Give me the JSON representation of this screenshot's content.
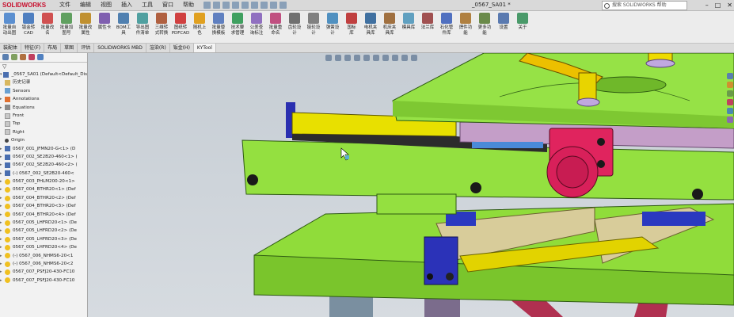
{
  "app": {
    "logo_text": "SOLIDWORKS",
    "doc_title": "_0567_SA01 *",
    "search_placeholder": "搜索 SOLIDWORKS 帮助",
    "menus": [
      "文件",
      "编辑",
      "视图",
      "插入",
      "工具",
      "窗口",
      "帮助"
    ]
  },
  "ribbon": {
    "buttons": [
      {
        "label": "批量自\n动出图",
        "color": "#5b8fd0"
      },
      {
        "label": "钣金转\nCAD",
        "color": "#4f7fc0"
      },
      {
        "label": "批量改\n名",
        "color": "#d05050"
      },
      {
        "label": "批量加\n图号",
        "color": "#60a060"
      },
      {
        "label": "批量改\n属性",
        "color": "#c09030"
      },
      {
        "label": "属性卡",
        "color": "#8060b0"
      },
      {
        "label": "BOM工\n具",
        "color": "#5080b0"
      },
      {
        "label": "导出图\n件清单",
        "color": "#50a0a0"
      },
      {
        "label": "三维转\n式转换",
        "color": "#b06040"
      },
      {
        "label": "图纸转\nPDFCAD",
        "color": "#d04040"
      },
      {
        "label": "随机上\n色",
        "color": "#e0a020"
      },
      {
        "label": "批量替\n换模板",
        "color": "#6080c0"
      },
      {
        "label": "技术要\n求管理",
        "color": "#40a060"
      },
      {
        "label": "公差查\n询标注",
        "color": "#9070c0"
      },
      {
        "label": "批量重\n命名",
        "color": "#c05080"
      },
      {
        "label": "齿轮设\n计",
        "color": "#707070"
      },
      {
        "label": "链轮设\n计",
        "color": "#808080"
      },
      {
        "label": "弹簧设\n计",
        "color": "#5090c0"
      },
      {
        "label": "国标\n库",
        "color": "#c04040"
      },
      {
        "label": "电机夹\n具库",
        "color": "#4070a0"
      },
      {
        "label": "机床夹\n具库",
        "color": "#a07040"
      },
      {
        "label": "模具库",
        "color": "#60a0c0"
      },
      {
        "label": "法兰库",
        "color": "#a05050"
      },
      {
        "label": "石化管\n件库",
        "color": "#5070c0"
      },
      {
        "label": "焊件功\n能",
        "color": "#b08040"
      },
      {
        "label": "更多功\n能",
        "color": "#6a8a4a"
      },
      {
        "label": "设置",
        "color": "#5a7ab0"
      },
      {
        "label": "关于",
        "color": "#4a9a6a"
      }
    ]
  },
  "tabs": [
    "装配体",
    "特征(F)",
    "布局",
    "草图",
    "评估",
    "SOLIDWORKS MBD",
    "渲染(R)",
    "钣金(H)",
    "KYTool"
  ],
  "tabs_active_index": 8,
  "tree": {
    "root": "_0567_SA01 (Default<Default_Dis",
    "items": [
      {
        "icon": "folder",
        "label": "历史记录",
        "exp": ""
      },
      {
        "icon": "sensor",
        "label": "Sensors",
        "exp": ""
      },
      {
        "icon": "annot",
        "label": "Annotations",
        "exp": "▸"
      },
      {
        "icon": "eq",
        "label": "Equations",
        "exp": "▸"
      },
      {
        "icon": "plane",
        "label": "Front",
        "exp": ""
      },
      {
        "icon": "plane",
        "label": "Top",
        "exp": ""
      },
      {
        "icon": "plane",
        "label": "Right",
        "exp": ""
      },
      {
        "icon": "origin",
        "label": "Origin",
        "exp": ""
      },
      {
        "icon": "asm",
        "label": "0567_001_JFMN20-G<1> (D",
        "exp": "▸"
      },
      {
        "icon": "asm",
        "label": "0567_002_SE2B20-460<1> (",
        "exp": "▸"
      },
      {
        "icon": "asm",
        "label": "0567_002_SE2B20-460<2> (",
        "exp": "▸"
      },
      {
        "icon": "asm",
        "label": "(-) 0567_002_SE2B20-460<",
        "exp": "▸"
      },
      {
        "icon": "part",
        "label": "0567_003_PHLM200-20<1>",
        "exp": "▸"
      },
      {
        "icon": "part",
        "label": "0567_004_BTHR20<1> (Def",
        "exp": "▸"
      },
      {
        "icon": "part",
        "label": "0567_004_BTHR20<2> (Def",
        "exp": "▸"
      },
      {
        "icon": "part",
        "label": "0567_004_BTHR20<3> (Def",
        "exp": "▸"
      },
      {
        "icon": "part",
        "label": "0567_004_BTHR20<4> (Def",
        "exp": "▸"
      },
      {
        "icon": "part",
        "label": "0567_005_LHFRD20<1> (De",
        "exp": "▸"
      },
      {
        "icon": "part",
        "label": "0567_005_LHFRD20<2> (De",
        "exp": "▸"
      },
      {
        "icon": "part",
        "label": "0567_005_LHFRD20<3> (De",
        "exp": "▸"
      },
      {
        "icon": "part",
        "label": "0567_005_LHFRD20<4> (De",
        "exp": "▸"
      },
      {
        "icon": "part",
        "label": "(-) 0567_006_NHMS6-20<1",
        "exp": "▸"
      },
      {
        "icon": "part",
        "label": "(-) 0567_006_NHMS6-20<2",
        "exp": "▸"
      },
      {
        "icon": "part",
        "label": "0567_007_PSFJ20-430-FC10",
        "exp": "▸"
      },
      {
        "icon": "part",
        "label": "0567_007_PSFJ20-430-FC10",
        "exp": "▸"
      }
    ]
  }
}
